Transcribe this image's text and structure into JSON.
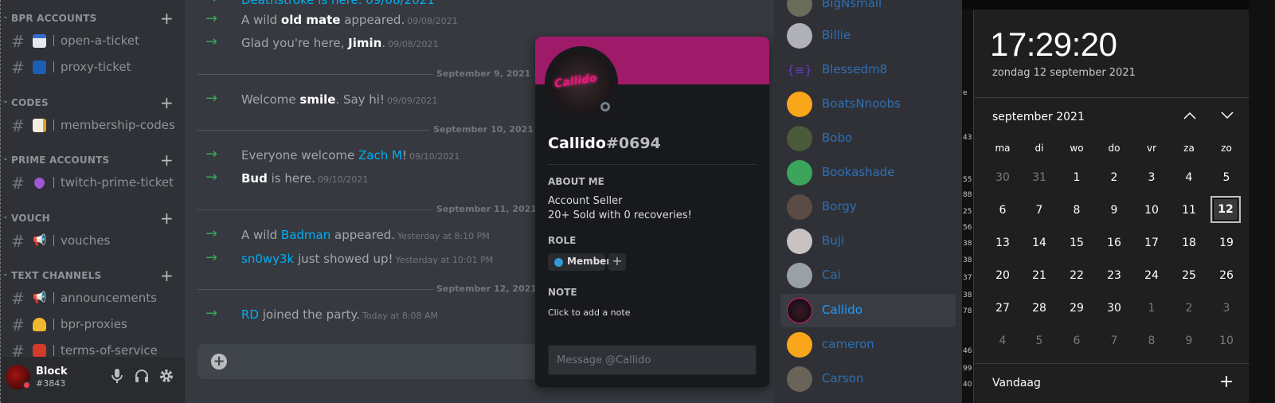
{
  "sidebar": {
    "categories": [
      {
        "label": "BPR ACCOUNTS"
      },
      {
        "label": "CODES"
      },
      {
        "label": "PRIME ACCOUNTS"
      },
      {
        "label": "VOUCH"
      },
      {
        "label": "TEXT CHANNELS"
      }
    ],
    "channels": [
      {
        "name": "open-a-ticket",
        "icon": "ticket-emoji"
      },
      {
        "name": "proxy-ticket",
        "icon": "signal-emoji"
      },
      {
        "name": "membership-codes",
        "icon": "memo-emoji"
      },
      {
        "name": "twitch-prime-ticket",
        "icon": "purple-heart-emoji"
      },
      {
        "name": "vouches",
        "icon": "megaphone-emoji"
      },
      {
        "name": "announcements",
        "icon": "megaphone-emoji"
      },
      {
        "name": "bpr-proxies",
        "icon": "bell-emoji"
      },
      {
        "name": "terms-of-service",
        "icon": "ticket-emoji"
      }
    ],
    "user": {
      "name": "Block",
      "tag": "#3843"
    }
  },
  "chat": {
    "messages": [
      {
        "pre": "A wild ",
        "strong": "old mate",
        "post": " appeared.",
        "ts": "09/08/2021"
      },
      {
        "pre": "Glad you're here, ",
        "strong": "Jimin",
        "post": ".",
        "ts": "09/08/2021"
      },
      {
        "pre": "Welcome ",
        "strong": "smile",
        "post": ". Say hi!",
        "ts": "09/09/2021"
      },
      {
        "pre": "Everyone welcome ",
        "link": "Zach M",
        "post": "!",
        "ts": "09/10/2021"
      },
      {
        "strong": "Bud",
        "post": " is here.",
        "ts": "09/10/2021"
      },
      {
        "pre": "A wild ",
        "link": "Badman",
        "post": " appeared.",
        "ts": "Yesterday at 8:10 PM"
      },
      {
        "link": "sn0wy3k",
        "post": " just showed up!",
        "ts": "Yesterday at 10:01 PM"
      },
      {
        "link": "RD",
        "post": " joined the party.",
        "ts": "Today at 8:08 AM"
      }
    ],
    "dividers": [
      "September 9, 2021",
      "September 10, 2021",
      "September 11, 2021",
      "September 12, 2021"
    ]
  },
  "popout": {
    "name": "Callido",
    "discriminator": "#0694",
    "avatar_text": "Callido",
    "about_header": "ABOUT ME",
    "about_line1": "Account Seller",
    "about_line2": "20+ Sold with 0 recoveries!",
    "role_header": "ROLE",
    "role_name": "Member",
    "role_color": "#3498db",
    "note_header": "NOTE",
    "note_text": "Click to add a note",
    "message_placeholder": "Message @Callido",
    "banner_color": "#9f1b6a"
  },
  "members": [
    {
      "name": "BigNsmall"
    },
    {
      "name": "Billie"
    },
    {
      "name": "Blessedm8"
    },
    {
      "name": "BoatsNnoobs"
    },
    {
      "name": "Bobo"
    },
    {
      "name": "Bookashade"
    },
    {
      "name": "Borgy"
    },
    {
      "name": "Buji"
    },
    {
      "name": "Cai"
    },
    {
      "name": "Callido",
      "selected": true
    },
    {
      "name": "cameron"
    },
    {
      "name": "Carson"
    }
  ],
  "calendar": {
    "time": "17:29:20",
    "date": "zondag 12 september 2021",
    "month": "september 2021",
    "weekdays": [
      "ma",
      "di",
      "wo",
      "do",
      "vr",
      "za",
      "zo"
    ],
    "weeks": [
      [
        "30",
        "31",
        "1",
        "2",
        "3",
        "4",
        "5"
      ],
      [
        "6",
        "7",
        "8",
        "9",
        "10",
        "11",
        "12"
      ],
      [
        "13",
        "14",
        "15",
        "16",
        "17",
        "18",
        "19"
      ],
      [
        "20",
        "21",
        "22",
        "23",
        "24",
        "25",
        "26"
      ],
      [
        "27",
        "28",
        "29",
        "30",
        "1",
        "2",
        "3"
      ],
      [
        "4",
        "5",
        "6",
        "7",
        "8",
        "9",
        "10"
      ]
    ],
    "today_label": "Vandaag",
    "left_edge_numbers": [
      "e",
      "43",
      "55",
      "88",
      "25",
      "56",
      "38",
      "38",
      "37",
      "38",
      "78",
      "46",
      "99",
      "40"
    ]
  }
}
